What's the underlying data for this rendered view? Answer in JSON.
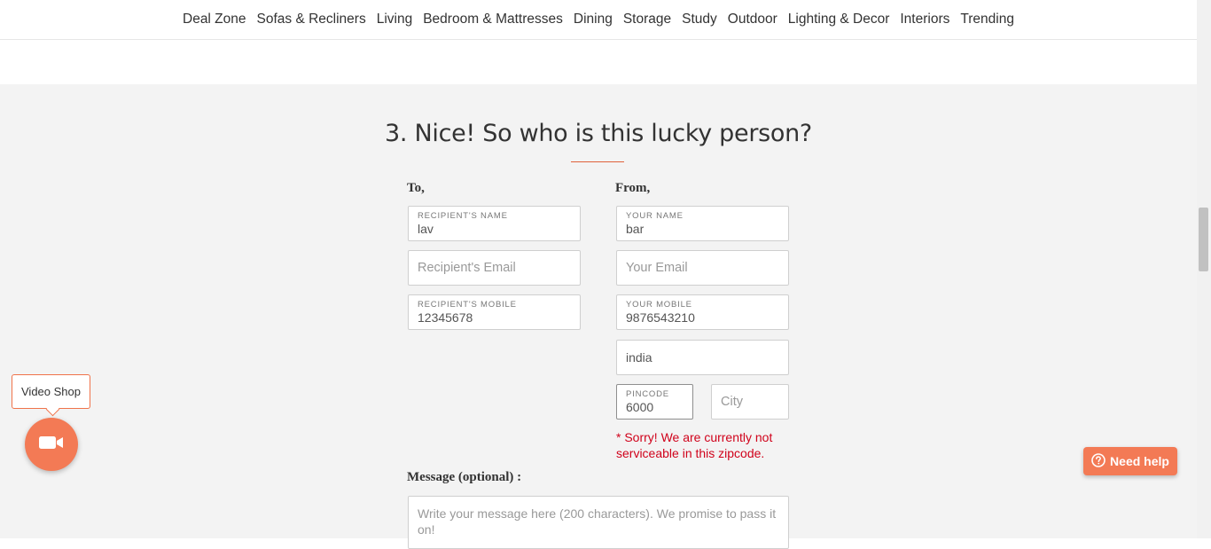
{
  "nav": {
    "items": [
      "Deal Zone",
      "Sofas & Recliners",
      "Living",
      "Bedroom & Mattresses",
      "Dining",
      "Storage",
      "Study",
      "Outdoor",
      "Lighting & Decor",
      "Interiors",
      "Trending"
    ]
  },
  "form": {
    "heading": "3. Nice! So who is this lucky person?",
    "to_label": "To,",
    "from_label": "From,",
    "recipient_name": {
      "label": "RECIPIENT'S NAME",
      "value": "lav"
    },
    "recipient_email": {
      "placeholder": "Recipient's Email"
    },
    "recipient_mobile": {
      "label": "RECIPIENT'S MOBILE",
      "value": "12345678"
    },
    "your_name": {
      "label": "YOUR NAME",
      "value": "bar"
    },
    "your_email": {
      "placeholder": "Your Email"
    },
    "your_mobile": {
      "label": "YOUR MOBILE",
      "value": "9876543210"
    },
    "country": {
      "value": "india"
    },
    "pincode": {
      "label": "PINCODE",
      "value": "6000"
    },
    "city": {
      "placeholder": "City"
    },
    "error": "* Sorry! We are currently not serviceable in this zipcode.",
    "message_label": "Message (optional) :",
    "message_placeholder": "Write your message here (200 characters). We promise to pass it on!"
  },
  "widgets": {
    "video_shop_label": "Video Shop",
    "need_help_label": "Need help",
    "accent_color": "#f37a55",
    "error_color": "#d0021b"
  }
}
